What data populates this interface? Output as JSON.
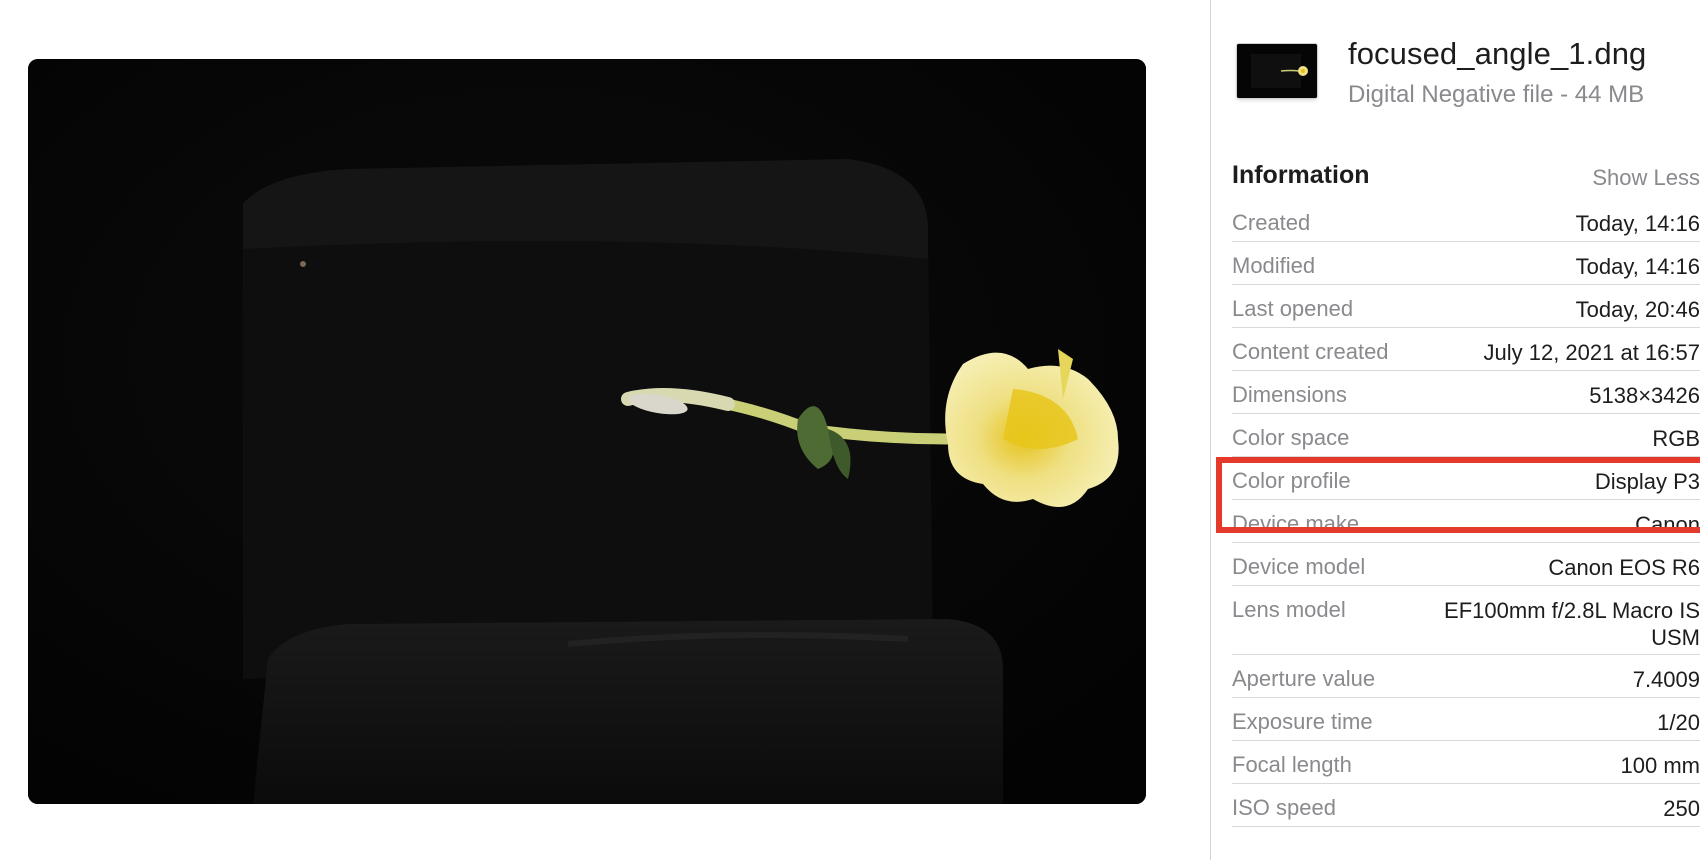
{
  "file": {
    "name": "focused_angle_1.dng",
    "kind_size": "Digital Negative file - 44 MB"
  },
  "information": {
    "title": "Information",
    "toggle_label": "Show Less",
    "rows": [
      {
        "key": "Created",
        "value": "Today, 14:16"
      },
      {
        "key": "Modified",
        "value": "Today, 14:16"
      },
      {
        "key": "Last opened",
        "value": "Today, 20:46"
      },
      {
        "key": "Content created",
        "value": "July 12, 2021 at 16:57"
      },
      {
        "key": "Dimensions",
        "value": "5138×3426"
      },
      {
        "key": "Color space",
        "value": "RGB"
      },
      {
        "key": "Color profile",
        "value": "Display P3"
      },
      {
        "key": "Device make",
        "value": "Canon"
      },
      {
        "key": "Device model",
        "value": "Canon EOS R6"
      },
      {
        "key": "Lens model",
        "value": "EF100mm f/2.8L Macro IS USM"
      },
      {
        "key": "Aperture value",
        "value": "7.4009"
      },
      {
        "key": "Exposure time",
        "value": "1/20"
      },
      {
        "key": "Focal length",
        "value": "100 mm"
      },
      {
        "key": "ISO speed",
        "value": "250"
      }
    ]
  },
  "highlight": {
    "target": "Color profile",
    "color": "#e5392b"
  },
  "colors": {
    "flower": "#f2e79a",
    "flower_center": "#e8c81f",
    "stem": "#c9cf77",
    "background": "#040404"
  }
}
